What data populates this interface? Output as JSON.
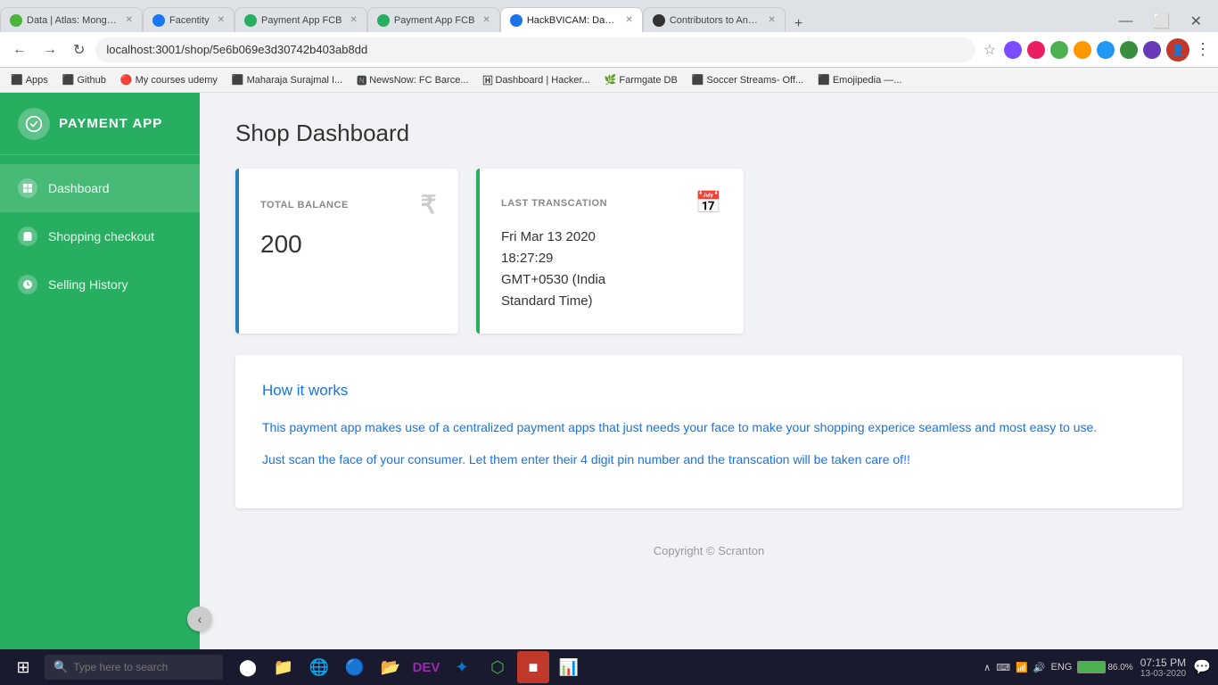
{
  "browser": {
    "address": "localhost:3001/shop/5e6b069e3d30742b403ab8dd",
    "tabs": [
      {
        "id": 1,
        "title": "Data | Atlas: MongoDB",
        "favicon_color": "#4db33d",
        "active": false
      },
      {
        "id": 2,
        "title": "Facentity",
        "favicon_color": "#1877f2",
        "active": false
      },
      {
        "id": 3,
        "title": "Payment App FCB",
        "favicon_color": "#27ae60",
        "active": false
      },
      {
        "id": 4,
        "title": "Payment App FCB",
        "favicon_color": "#27ae60",
        "active": false
      },
      {
        "id": 5,
        "title": "HackBVICAM: Dashbo...",
        "favicon_color": "#1a73e8",
        "active": true
      },
      {
        "id": 6,
        "title": "Contributors to Anantr...",
        "favicon_color": "#333",
        "active": false
      }
    ],
    "bookmarks": [
      {
        "label": "Apps",
        "icon": "⬛"
      },
      {
        "label": "Github",
        "icon": "⬛"
      },
      {
        "label": "My courses udemy",
        "icon": "🔴"
      },
      {
        "label": "Maharaja Surajmal I...",
        "icon": "⬛"
      },
      {
        "label": "NewsNow: FC Barce...",
        "icon": "🅽"
      },
      {
        "label": "Dashboard | Hacker...",
        "icon": "🄷"
      },
      {
        "label": "Farmgate DB",
        "icon": "🌿"
      },
      {
        "label": "Soccer Streams- Off...",
        "icon": "⬛"
      },
      {
        "label": "Emojipedia —...",
        "icon": "⬛"
      }
    ]
  },
  "sidebar": {
    "app_name": "PAYMENT APP",
    "items": [
      {
        "label": "Dashboard",
        "active": true
      },
      {
        "label": "Shopping checkout",
        "active": false
      },
      {
        "label": "Selling History",
        "active": false
      }
    ],
    "toggle_icon": "‹"
  },
  "main": {
    "page_title": "Shop Dashboard",
    "balance_card": {
      "label": "TOTAL BALANCE",
      "value": "200",
      "icon": "₹"
    },
    "transaction_card": {
      "label": "LAST TRANSCATION",
      "date_line1": "Fri Mar 13 2020",
      "date_line2": "18:27:29",
      "date_line3": "GMT+0530 (India",
      "date_line4": "Standard Time)"
    },
    "how_section": {
      "title": "How it works",
      "text1": "This payment app makes use of a centralized payment apps that just needs your face to make your shopping experice seamless and most easy to use.",
      "text2": "Just scan the face of your consumer. Let them enter their 4 digit pin number and the transcation will be taken care of!!"
    },
    "footer": "Copyright © Scranton"
  },
  "taskbar": {
    "search_placeholder": "Type here to search",
    "clock_time": "07:15 PM",
    "clock_date": "13-03-2020",
    "battery_label": "86.0%",
    "language": "ENG"
  }
}
